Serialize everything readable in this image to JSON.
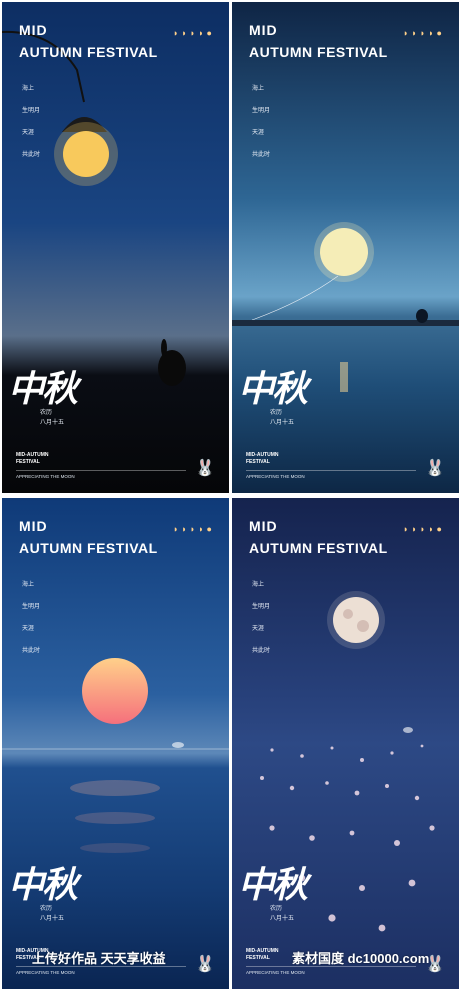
{
  "header": {
    "line1": "MID",
    "line2": "AUTUMN FESTIVAL",
    "moon_phases": "◗◗◗◗●"
  },
  "poem": [
    "海上",
    "生明月",
    "天涯",
    "共此时"
  ],
  "calligraphy": "中秋",
  "lunar_date": [
    "农历",
    "八月十五"
  ],
  "subtitle": [
    "MID-AUTUMN",
    "FESTIVAL"
  ],
  "footer": "APPRECIATING THE MOON",
  "rabbit_icon": "rabbit-icon",
  "watermark": {
    "left": "上传好作品  天天享收益",
    "right": "素材国度  dc10000.com"
  },
  "colors": {
    "moon_glow": "#ffd089",
    "sunset_moon": "#f6a27a",
    "text": "#ffffff"
  }
}
